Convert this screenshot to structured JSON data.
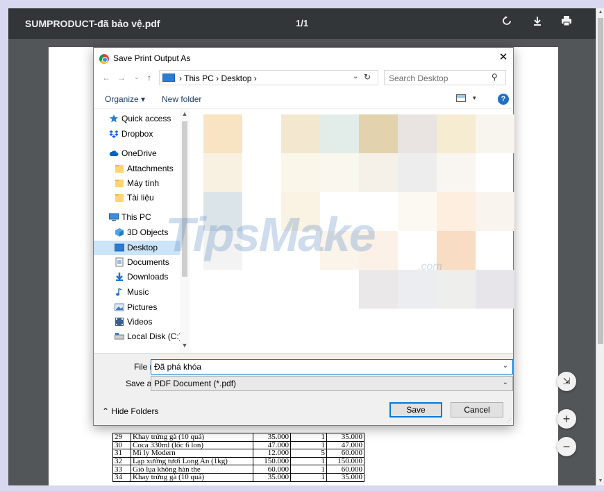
{
  "viewer": {
    "file_title": "SUMPRODUCT-đã bảo vệ.pdf",
    "page_indicator": "1/1"
  },
  "table_rows": [
    [
      "29",
      "Khay trứng gà (10 quả)",
      "35.000",
      "1",
      "35.000"
    ],
    [
      "30",
      "Coca 330ml (lốc 6 lon)",
      "47.000",
      "1",
      "47.000"
    ],
    [
      "31",
      "Mì ly Modern",
      "12.000",
      "5",
      "60.000"
    ],
    [
      "32",
      "Lạp xưởng tươi Long An (1kg)",
      "150.000",
      "1",
      "150.000"
    ],
    [
      "33",
      "Giò lụa không hàn the",
      "60.000",
      "1",
      "60.000"
    ],
    [
      "34",
      "Khay trứng gà (10 quả)",
      "35.000",
      "1",
      "35.000"
    ]
  ],
  "dialog": {
    "title": "Save Print Output As",
    "close_glyph": "✕",
    "nav": {
      "back_glyph": "←",
      "forward_glyph": "→",
      "recent_glyph": "⌄",
      "up_glyph": "↑"
    },
    "address": {
      "text": "› This PC › Desktop ›",
      "dropdown_glyph": "⌄",
      "refresh_glyph": "↻"
    },
    "search": {
      "placeholder": "Search Desktop",
      "icon_glyph": "⚲"
    },
    "commands": {
      "organize": "Organize ▾",
      "new_folder": "New folder",
      "view_dropdown": "▾",
      "help": "?"
    },
    "nav_items": [
      {
        "label": "Quick access",
        "icon": "star-icon",
        "indent": 0
      },
      {
        "label": "Dropbox",
        "icon": "dropbox-icon",
        "indent": 0
      },
      {
        "label": "OneDrive",
        "icon": "cloud-icon",
        "indent": 0
      },
      {
        "label": "Attachments",
        "icon": "folder-icon",
        "indent": 1
      },
      {
        "label": "Máy tính",
        "icon": "folder-icon",
        "indent": 1
      },
      {
        "label": "Tài liệu",
        "icon": "folder-icon",
        "indent": 1
      },
      {
        "label": "This PC",
        "icon": "computer-icon",
        "indent": 0
      },
      {
        "label": "3D Objects",
        "icon": "cube-icon",
        "indent": 1
      },
      {
        "label": "Desktop",
        "icon": "desktop-icon",
        "indent": 1,
        "selected": true
      },
      {
        "label": "Documents",
        "icon": "document-icon",
        "indent": 1
      },
      {
        "label": "Downloads",
        "icon": "download-icon",
        "indent": 1
      },
      {
        "label": "Music",
        "icon": "music-icon",
        "indent": 1
      },
      {
        "label": "Pictures",
        "icon": "pictures-icon",
        "indent": 1
      },
      {
        "label": "Videos",
        "icon": "video-icon",
        "indent": 1
      },
      {
        "label": "Local Disk (C:)",
        "icon": "disk-icon",
        "indent": 1
      }
    ],
    "watermark": {
      "main": "TipsMake",
      "suffix": ".com"
    },
    "form": {
      "file_name_label": "File name:",
      "file_name_value": "Đã phá khóa",
      "save_type_label": "Save as type:",
      "save_type_value": "PDF Document (*.pdf)",
      "hide_folders": "Hide Folders",
      "save_button": "Save",
      "cancel_button": "Cancel"
    }
  },
  "fab": {
    "fit": "⇲",
    "zoom_in": "+",
    "zoom_out": "−"
  },
  "colors": {
    "toolbar": "#323639",
    "viewer_bg": "#525659",
    "accent": "#0078d7",
    "selected": "#cce4f7"
  }
}
